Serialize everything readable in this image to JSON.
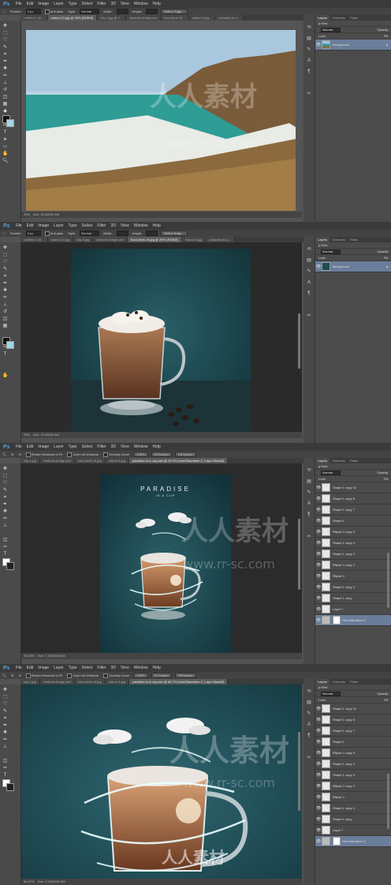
{
  "app": {
    "logo": "Ps"
  },
  "menu": [
    "File",
    "Edit",
    "Image",
    "Layer",
    "Type",
    "Select",
    "Filter",
    "3D",
    "View",
    "Window",
    "Help"
  ],
  "options_select": {
    "feather_label": "Feather:",
    "feather_value": "0 px",
    "antialias_label": "Anti-alias",
    "style_label": "Style:",
    "style_value": "Normal",
    "width_label": "Width:",
    "height_label": "Height:",
    "refine_button": "Refine Edge..."
  },
  "options_zoom": {
    "resize_label": "Resize Windows to Fit",
    "zoom_all_label": "Zoom All Windows",
    "scrubby_label": "Scrubby Zoom",
    "button_100": "100%",
    "fit_screen": "Fit Screen",
    "fill_screen": "Fill Screen"
  },
  "layers_panel": {
    "tabs": [
      "Layers",
      "Channels",
      "Paths"
    ],
    "kind_label": "ρ Kind",
    "blend_mode": "Normal",
    "opacity_label": "Opacity:",
    "lock_label": "Lock:",
    "fill_label": "Fill:"
  },
  "panels": [
    {
      "tabs": [
        "Untitled-1 @...",
        "nature-10.jpg @ 25% (RGB/8)",
        "city-4.jpg @ 2...",
        "sinkhole-bridge.psd",
        "food-drink-15...",
        "nature-5.jpg...",
        "paradise-in-a..."
      ],
      "active_tab": 1,
      "zoom": "25%",
      "doc": "Doc: 22.4M/22.4M",
      "layers": [
        {
          "name": "Background",
          "selected": true
        }
      ]
    },
    {
      "tabs": [
        "Untitled-1 @...",
        "nature-10.jpg",
        "city-4.jpg",
        "sinkhole-bridge.psd",
        "food-drink-15.jpg @ 25% (RGB/8)",
        "nature-5.jpg",
        "paradise-in-a-..."
      ],
      "active_tab": 4,
      "zoom": "25%",
      "doc": "Doc: 22.4M/22.4M",
      "layers": [
        {
          "name": "Background",
          "selected": true
        }
      ]
    },
    {
      "tabs": [
        "city-4.jpg",
        "sinkhole-bridge.psd",
        "food-drink-15.jpg",
        "nature-5.jpg",
        "paradise-in-a-cup.psd @ 33.3% (Hue/Saturation 2, Layer Mask/8)"
      ],
      "active_tab": 4,
      "zoom": "33.33%",
      "doc": "Doc: 7.32M/163.4M",
      "poster_title": "PARADISE",
      "poster_subtitle": "IN A CUP",
      "layers": [
        {
          "name": "Shape 1 copy 10"
        },
        {
          "name": "Shape 1 copy 8"
        },
        {
          "name": "Shape 1 copy 7"
        },
        {
          "name": "Shape 1"
        },
        {
          "name": "Ellipse 1 copy 5"
        },
        {
          "name": "Shape 1 copy 4"
        },
        {
          "name": "Shape 1 copy 3"
        },
        {
          "name": "Ellipse 1 copy 2"
        },
        {
          "name": "Ellipse 1"
        },
        {
          "name": "Shape 1 copy 2"
        },
        {
          "name": "Shape 1 copy"
        },
        {
          "name": "Layer 7"
        },
        {
          "name": "Hue/Saturation 2",
          "selected": true
        }
      ]
    },
    {
      "tabs": [
        "city-4.jpg",
        "sinkhole-bridge.psd",
        "food-drink-15.jpg",
        "nature-5.jpg",
        "paradise-in-a-cup.psd @ 66.7% (Hue/Saturation 2, Layer Mask/8)"
      ],
      "active_tab": 4,
      "zoom": "66.67%",
      "doc": "Doc: 7.32M/163.4M",
      "layers": [
        {
          "name": "Shape 1 copy 10"
        },
        {
          "name": "Shape 1 copy 8"
        },
        {
          "name": "Shape 1 copy 7"
        },
        {
          "name": "Shape 1"
        },
        {
          "name": "Ellipse 1 copy 5"
        },
        {
          "name": "Shape 1 copy 4"
        },
        {
          "name": "Shape 1 copy 3"
        },
        {
          "name": "Ellipse 1 copy 2"
        },
        {
          "name": "Ellipse 1"
        },
        {
          "name": "Shape 1 copy 2"
        },
        {
          "name": "Shape 1 copy"
        },
        {
          "name": "Layer 7"
        },
        {
          "name": "Hue/Saturation 2",
          "selected": true
        }
      ]
    }
  ],
  "watermark": {
    "text": "人人素材",
    "url": "www.rr-sc.com"
  },
  "colors": {
    "accent": "#4fa3e0",
    "selected_layer": "#6a7d9a",
    "teal_bg": "#1f4a52"
  }
}
